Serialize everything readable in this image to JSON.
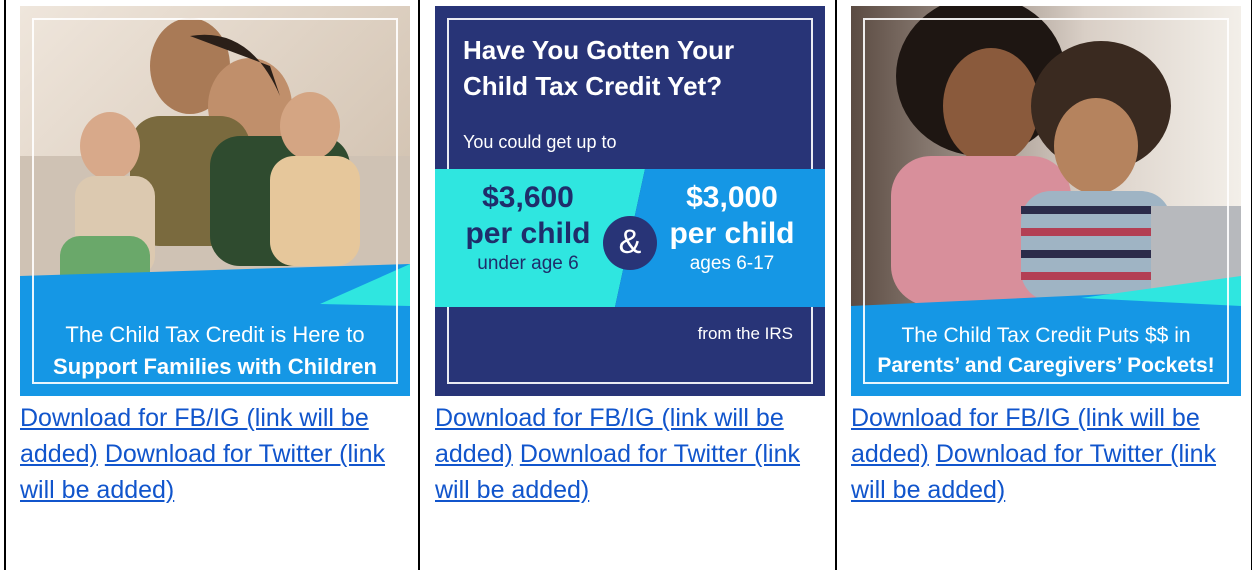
{
  "cards": [
    {
      "banner_line1": "The Child Tax Credit is Here to",
      "banner_line2": "Support Families with Children",
      "link_fb": "Download for FB/IG (link will be added)",
      "link_twitter": "Download for Twitter (link will be added)"
    },
    {
      "title": "Have You Gotten Your Child Tax Credit Yet?",
      "subtitle": "You could get up to",
      "left_amount": "$3,600",
      "left_unit": "per child",
      "left_age": "under age 6",
      "ampersand": "&",
      "right_amount": "$3,000",
      "right_unit": "per child",
      "right_age": "ages 6-17",
      "source": "from the IRS",
      "link_fb": "Download for FB/IG (link will be added)",
      "link_twitter": "Download for Twitter (link will be added)"
    },
    {
      "banner_line1": "The Child Tax Credit Puts $$ in",
      "banner_line2": "Parents’ and Caregivers’ Pockets!",
      "link_fb": "Download for FB/IG (link will be added)",
      "link_twitter": "Download for Twitter (link will be added)"
    }
  ],
  "colors": {
    "navy": "#283477",
    "cyan": "#2fe6e0",
    "blue": "#1597e5",
    "link": "#1155cc"
  }
}
